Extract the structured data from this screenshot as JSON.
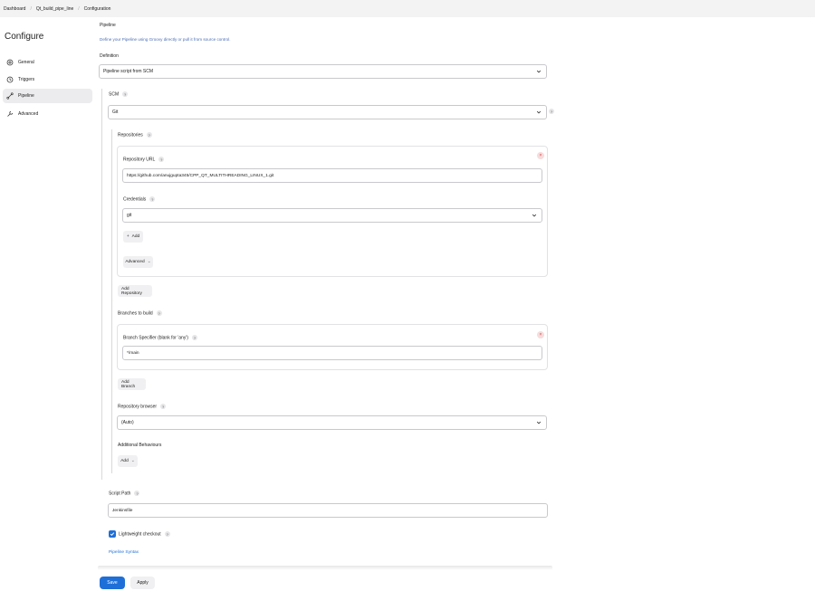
{
  "breadcrumb": [
    "Dashboard",
    "Qt_build_pipe_line",
    "Configuration"
  ],
  "page_title": "Configure",
  "sidebar": {
    "items": [
      {
        "label": "General",
        "icon": "gear-icon",
        "active": false
      },
      {
        "label": "Triggers",
        "icon": "clock-icon",
        "active": false
      },
      {
        "label": "Pipeline",
        "icon": "pipeline-icon",
        "active": true
      },
      {
        "label": "Advanced",
        "icon": "wrench-icon",
        "active": false
      }
    ]
  },
  "pipeline": {
    "section_title": "Pipeline",
    "description": "Define your Pipeline using Groovy directly or pull it from source control.",
    "definition_label": "Definition",
    "definition_value": "Pipeline script from SCM",
    "scm_label": "SCM",
    "scm_value": "Git",
    "repositories_label": "Repositories",
    "repository_url_label": "Repository URL",
    "repository_url_value": "https://github.com/anujgupta345/CPP_QT_MULTITHREADING_LINUX_1.git",
    "credentials_label": "Credentials",
    "credentials_value": "git",
    "add_label": "Add",
    "advanced_label": "Advanced",
    "add_repository_label": "Add Repository",
    "branches_label": "Branches to build",
    "branch_specifier_label": "Branch Specifier (blank for 'any')",
    "branch_specifier_value": "*/main",
    "add_branch_label": "Add Branch",
    "repository_browser_label": "Repository browser",
    "repository_browser_value": "(Auto)",
    "additional_behaviours_label": "Additional Behaviours",
    "add_behaviour_label": "Add",
    "script_path_label": "Script Path",
    "script_path_value": "Jenkinsfile",
    "lightweight_checkout_label": "Lightweight checkout",
    "lightweight_checkout_checked": true,
    "pipeline_syntax_label": "Pipeline Syntax"
  },
  "footer": {
    "save_label": "Save",
    "apply_label": "Apply"
  },
  "colors": {
    "accent": "#1f6fd8",
    "sidebar_active": "#ececee",
    "topbar": "#f3f3f4",
    "remove": "#d24848"
  }
}
